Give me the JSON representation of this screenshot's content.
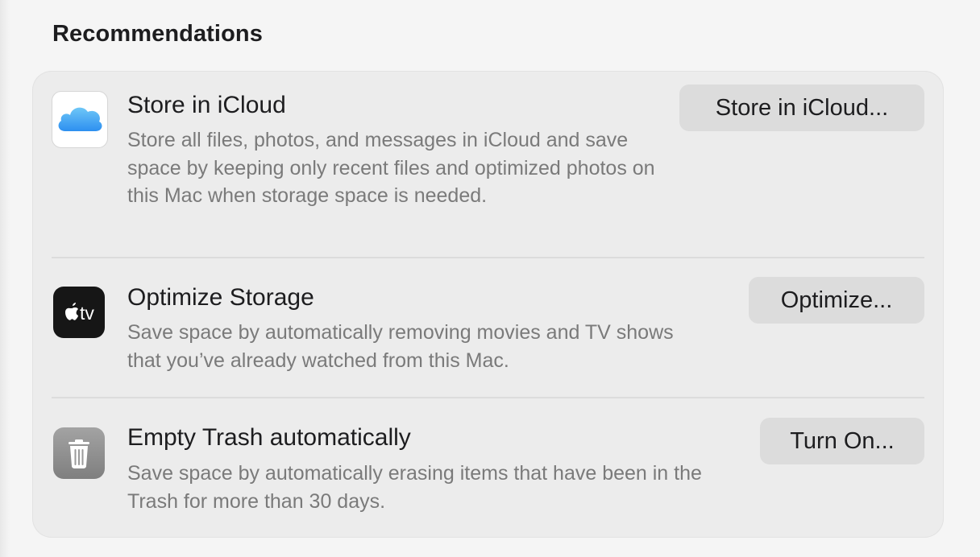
{
  "section": {
    "title": "Recommendations"
  },
  "rows": [
    {
      "title": "Store in iCloud",
      "description": "Store all files, photos, and messages in iCloud and save space by keeping only recent files and optimized photos on this Mac when storage space is needed.",
      "button_label": "Store in iCloud...",
      "icon": "icloud-icon"
    },
    {
      "title": "Optimize Storage",
      "description": "Save space by automatically removing movies and TV shows that you’ve already watched from this Mac.",
      "button_label": "Optimize...",
      "icon": "apple-tv-icon",
      "icon_text": "tv"
    },
    {
      "title": "Empty Trash automatically",
      "description": "Save space by automatically erasing items that have been in the Trash for more than 30 days.",
      "button_label": "Turn On...",
      "icon": "trash-icon"
    }
  ]
}
